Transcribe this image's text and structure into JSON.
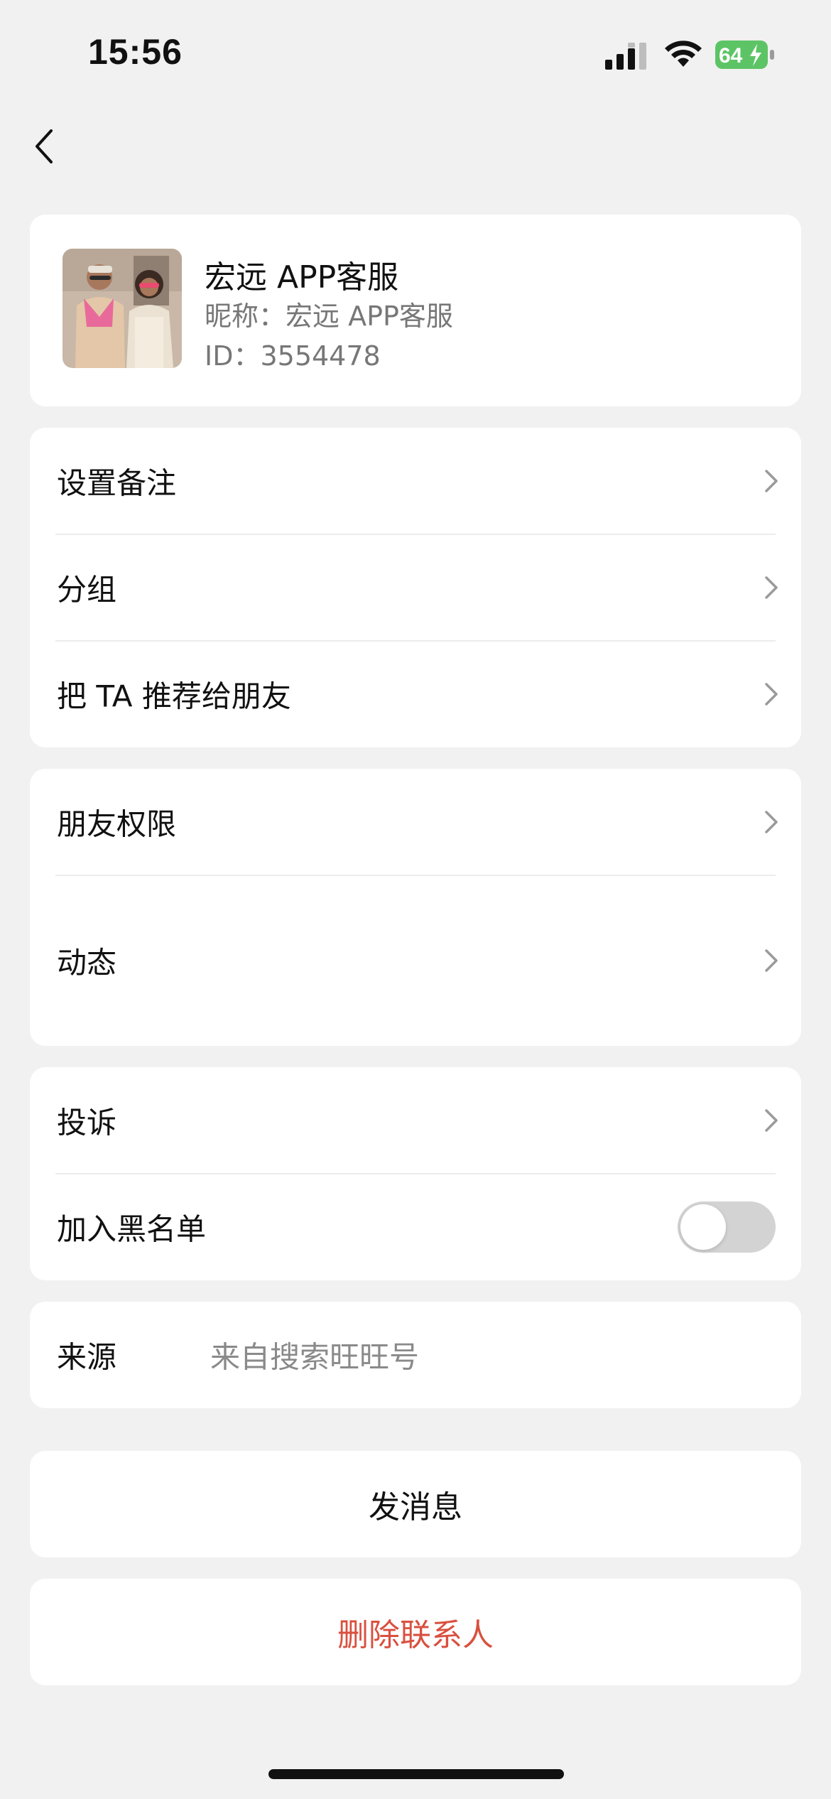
{
  "status_bar": {
    "time": "15:56",
    "battery_level": "64"
  },
  "profile": {
    "name": "宏远 APP客服",
    "nickname": "昵称：宏远 APP客服",
    "id_text": "ID：3554478"
  },
  "group1": {
    "set_remark": "设置备注",
    "group": "分组",
    "recommend": "把 TA 推荐给朋友"
  },
  "group2": {
    "friend_permission": "朋友权限",
    "moments": "动态"
  },
  "group3": {
    "complaint": "投诉",
    "blacklist": "加入黑名单",
    "blacklist_on": false
  },
  "source": {
    "label": "来源",
    "value": "来自搜索旺旺号"
  },
  "actions": {
    "send_message": "发消息",
    "delete_contact": "删除联系人"
  },
  "colors": {
    "background": "#f1f1f1",
    "card": "#ffffff",
    "danger": "#d9503f",
    "battery_green": "#5dc466"
  },
  "icons": [
    "back-chevron-icon",
    "chevron-right-icon",
    "signal-icon",
    "wifi-icon",
    "battery-icon",
    "bolt-icon"
  ]
}
